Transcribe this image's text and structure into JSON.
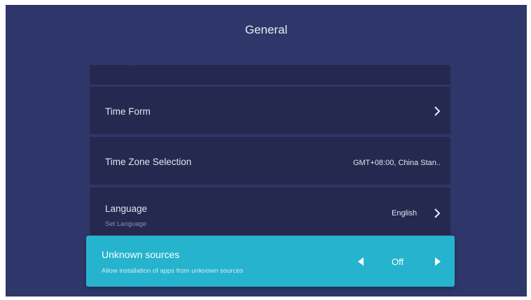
{
  "page": {
    "title": "General"
  },
  "settings": {
    "items": [
      {
        "label": "Time Form",
        "icon": "chevron-right-icon"
      },
      {
        "label": "Time Zone Selection",
        "value": "GMT+08:00, China Stan.."
      },
      {
        "label": "Language",
        "sublabel": "Set Language",
        "value": "English",
        "icon": "chevron-right-icon"
      }
    ],
    "focused": {
      "label": "Unknown sources",
      "sublabel": "Allow installation of apps from unknown sources",
      "value": "Off",
      "left_icon": "triangle-left-icon",
      "right_icon": "triangle-right-icon"
    }
  },
  "colors": {
    "background": "#2f376a",
    "row": "#25294f",
    "focus": "#25b3cd",
    "text": "#e2e4ef"
  }
}
